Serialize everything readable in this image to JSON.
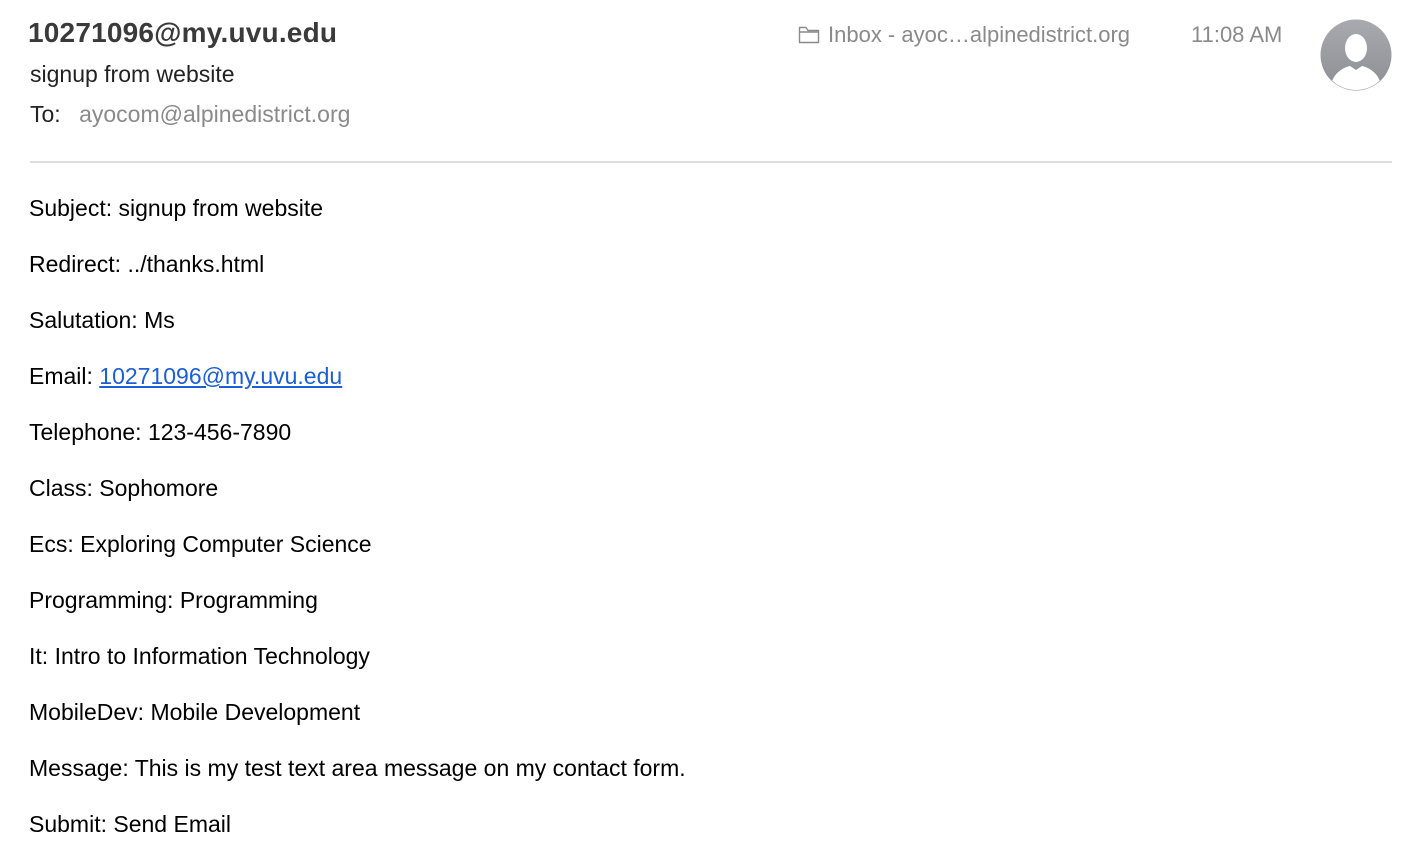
{
  "header": {
    "sender": "10271096@my.uvu.edu",
    "subject": "signup from website",
    "to_label": "To:",
    "to_value": "ayocom@alpinedistrict.org",
    "mailbox": "Inbox - ayoc…alpinedistrict.org",
    "time": "11:08 AM",
    "mailbox_icon": "folder-icon",
    "avatar_icon": "person-silhouette-icon"
  },
  "body": {
    "fields": [
      {
        "label": "Subject:",
        "value": "signup from website"
      },
      {
        "label": "Redirect:",
        "value": "../thanks.html"
      },
      {
        "label": "Salutation:",
        "value": "Ms"
      },
      {
        "label": "Email:",
        "value": "10271096@my.uvu.edu"
      },
      {
        "label": "Telephone:",
        "value": "123-456-7890"
      },
      {
        "label": "Class:",
        "value": "Sophomore"
      },
      {
        "label": "Ecs:",
        "value": "Exploring Computer Science"
      },
      {
        "label": "Programming:",
        "value": "Programming"
      },
      {
        "label": "It:",
        "value": "Intro to Information Technology"
      },
      {
        "label": "MobileDev:",
        "value": "Mobile Development"
      },
      {
        "label": "Message:",
        "value": "This is my test text area message on my contact form."
      },
      {
        "label": "Submit:",
        "value": "Send Email"
      }
    ]
  },
  "colors": {
    "link": "#1a5fd6",
    "muted": "#8a8a8a",
    "divider": "#dddddd",
    "avatar_bg": "#9b9ca1"
  }
}
